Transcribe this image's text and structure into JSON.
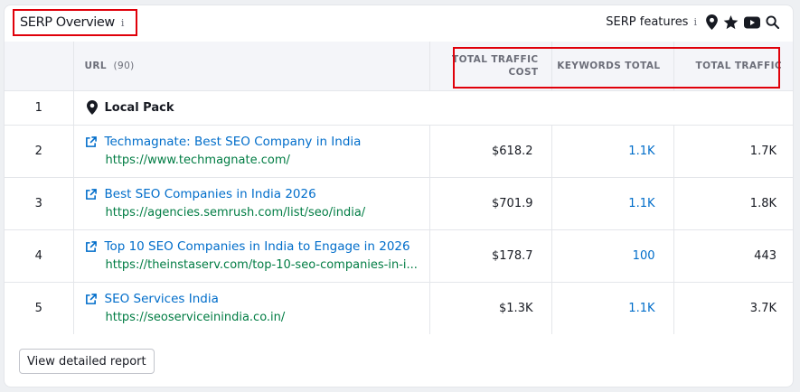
{
  "header": {
    "title": "SERP Overview",
    "info_glyph": "i",
    "features_label": "SERP features",
    "features_info_glyph": "i",
    "feature_icons": [
      "location-pin-icon",
      "star-icon",
      "youtube-icon",
      "search-icon"
    ]
  },
  "table": {
    "url_header": "URL",
    "url_count": "(90)",
    "col_cost": "TOTAL TRAFFIC COST",
    "col_keywords": "KEYWORDS TOTAL",
    "col_traffic": "TOTAL TRAFFIC",
    "local_pack": {
      "num": "1",
      "label": "Local Pack"
    },
    "rows": [
      {
        "num": "2",
        "title": "Techmagnate: Best SEO Company in India",
        "url": "https://www.techmagnate.com/",
        "cost": "$618.2",
        "keywords": "1.1K",
        "traffic": "1.7K"
      },
      {
        "num": "3",
        "title": "Best SEO Companies in India 2026",
        "url": "https://agencies.semrush.com/list/seo/india/",
        "cost": "$701.9",
        "keywords": "1.1K",
        "traffic": "1.8K"
      },
      {
        "num": "4",
        "title": "Top 10 SEO Companies in India to Engage in 2026",
        "url": "https://theinstaserv.com/top-10-seo-companies-in-i...",
        "cost": "$178.7",
        "keywords": "100",
        "traffic": "443"
      },
      {
        "num": "5",
        "title": "SEO Services India",
        "url": "https://seoserviceinindia.co.in/",
        "cost": "$1.3K",
        "keywords": "1.1K",
        "traffic": "3.7K"
      }
    ]
  },
  "footer": {
    "button_label": "View detailed report"
  },
  "colors": {
    "link": "#006dca",
    "url": "#007c43",
    "highlight": "#e0000a"
  }
}
